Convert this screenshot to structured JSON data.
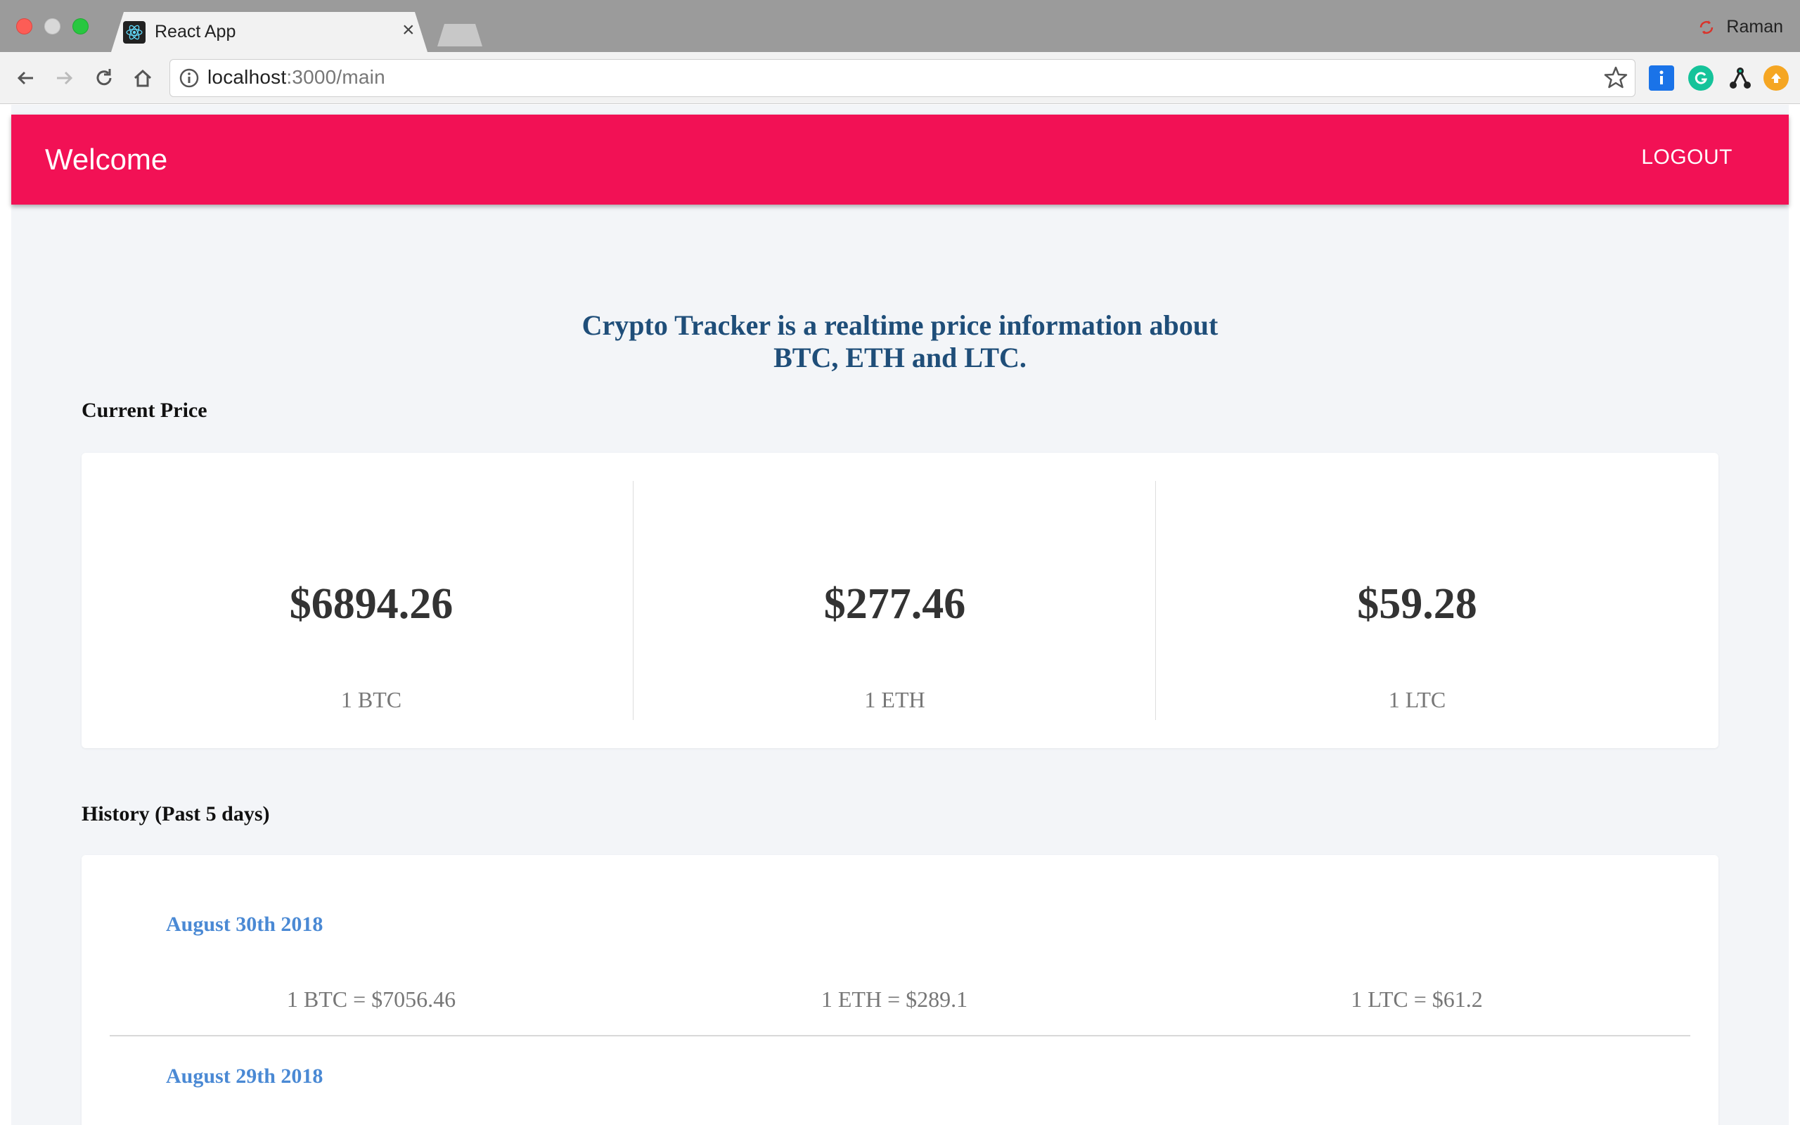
{
  "browser": {
    "tab_title": "React App",
    "tab_close": "×",
    "profile_name": "Raman",
    "url_host": "localhost",
    "url_path": ":3000/main"
  },
  "app": {
    "title": "Welcome",
    "logout_label": "LOGOUT",
    "headline_line1": "Crypto Tracker is a realtime price information about",
    "headline_line2": "BTC, ETH and LTC.",
    "current_price_label": "Current Price",
    "history_label": "History (Past 5 days)"
  },
  "prices": [
    {
      "value": "$6894.26",
      "unit": "1 BTC"
    },
    {
      "value": "$277.46",
      "unit": "1 ETH"
    },
    {
      "value": "$59.28",
      "unit": "1 LTC"
    }
  ],
  "history": [
    {
      "date": "August 30th 2018",
      "btc": "1 BTC = $7056.46",
      "eth": "1 ETH = $289.1",
      "ltc": "1 LTC = $61.2"
    },
    {
      "date": "August 29th 2018"
    }
  ],
  "colors": {
    "appbar": "#f21155",
    "headline": "#1f4e79",
    "date_link": "#4a89d4",
    "background": "#f3f5f8"
  }
}
